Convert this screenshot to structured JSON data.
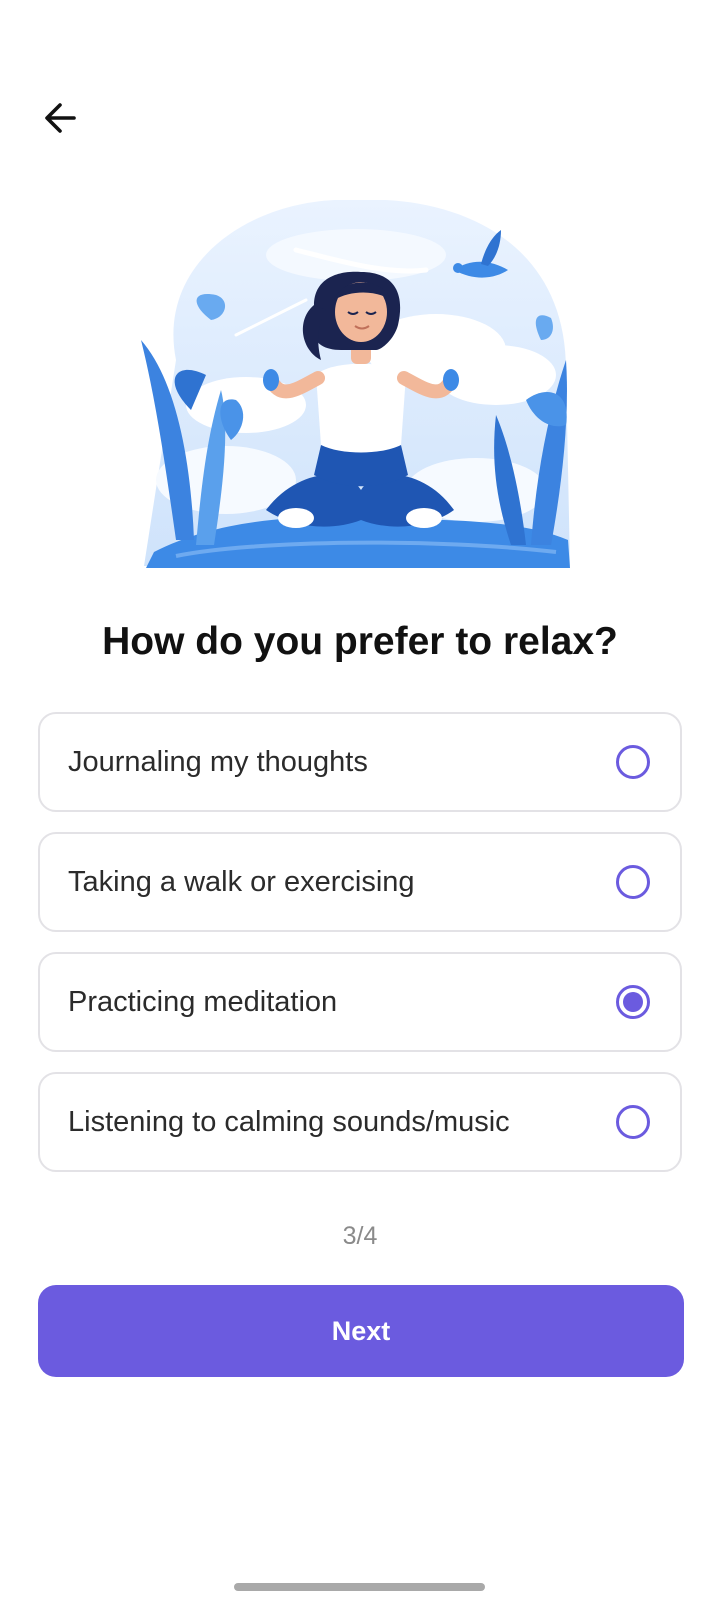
{
  "header": {
    "back_icon": "arrow-left-icon"
  },
  "hero": {
    "icon": "meditation-illustration"
  },
  "question": "How do you prefer to relax?",
  "options": [
    {
      "label": "Journaling my thoughts",
      "selected": false
    },
    {
      "label": "Taking a walk or exercising",
      "selected": false
    },
    {
      "label": "Practicing meditation",
      "selected": true
    },
    {
      "label": "Listening to calming sounds/music",
      "selected": false
    }
  ],
  "progress": "3/4",
  "next_button": {
    "label": "Next"
  },
  "colors": {
    "accent": "#6b5bdf",
    "border": "#e3e2e6",
    "progress_text": "#8a8a8a"
  }
}
